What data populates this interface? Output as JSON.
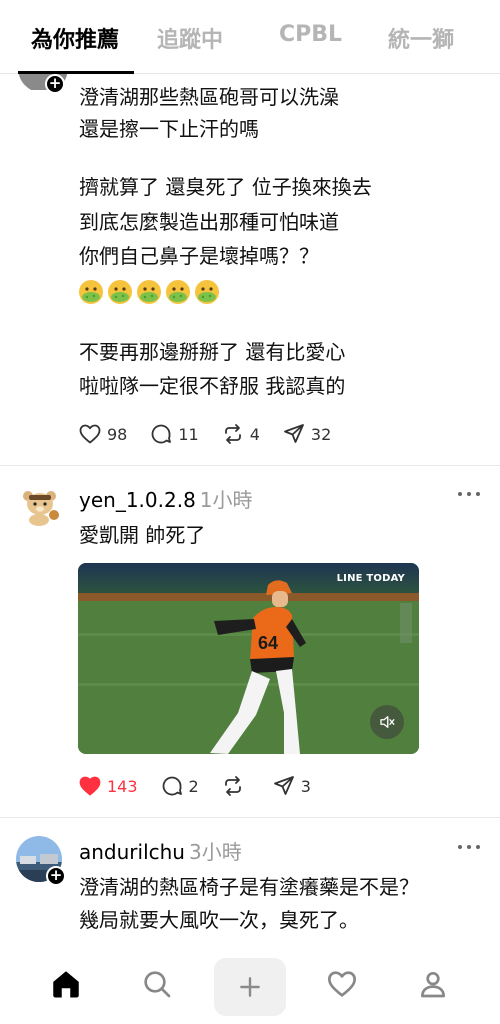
{
  "tabs": [
    {
      "label": "為你推薦",
      "active": true
    },
    {
      "label": "追蹤中",
      "active": false
    },
    {
      "label": "CPBL",
      "active": false
    },
    {
      "label": "統一獅",
      "active": false
    }
  ],
  "post1": {
    "lines_a": [
      "澄清湖那些熱區砲哥可以洗澡",
      "還是擦一下止汗的嗎"
    ],
    "lines_b": [
      "擠就算了 還臭死了 位子換來換去",
      "到底怎麼製造出那種可怕味道",
      "你們自己鼻子是壞掉嗎？？"
    ],
    "emoji": [
      "nauseated-face",
      "nauseated-face",
      "nauseated-face",
      "nauseated-face",
      "nauseated-face"
    ],
    "lines_c": [
      "不要再那邊掰掰了 還有比愛心",
      "啦啦隊一定很不舒服 我認真的"
    ],
    "likes": "98",
    "comments": "11",
    "reposts": "4",
    "shares": "32"
  },
  "post2": {
    "username": "yen_1.0.2.8",
    "time": "1小時",
    "text": "愛凱開 帥死了",
    "video_tag": "LINE TODAY",
    "likes": "143",
    "liked": true,
    "comments": "2",
    "reposts": "",
    "shares": "3"
  },
  "post3": {
    "username": "andurilchu",
    "time": "3小時",
    "lines": [
      "澄清湖的熱區椅子是有塗癢藥是不是？",
      "幾局就要大風吹一次，臭死了。"
    ]
  },
  "nav": [
    "home-icon",
    "search-icon",
    "create-icon",
    "activity-icon",
    "profile-icon"
  ],
  "colors": {
    "accent_like": "#ff3040",
    "muted": "#9a9a9a"
  }
}
